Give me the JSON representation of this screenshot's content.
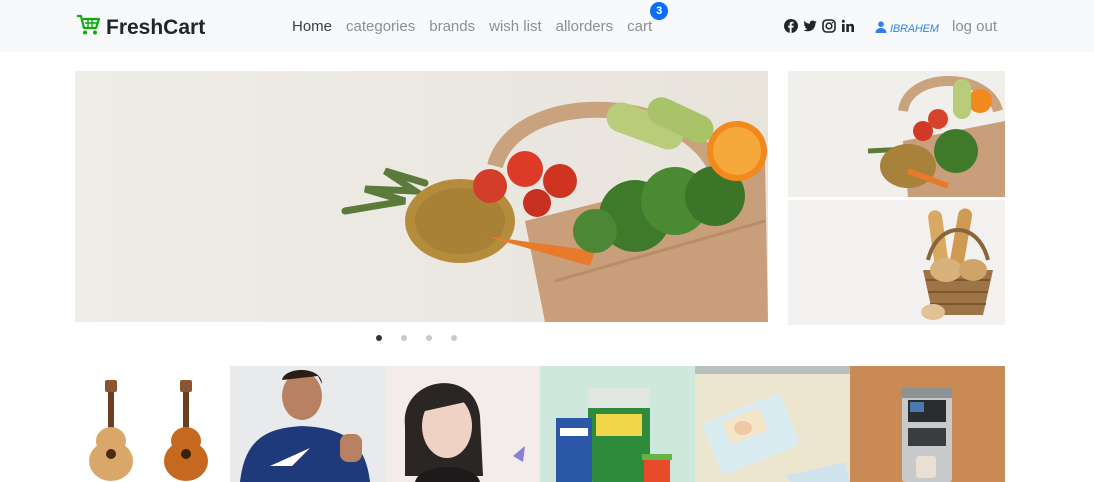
{
  "brand": {
    "name": "FreshCart",
    "icon": "cart-icon",
    "accent": "#0aad0a"
  },
  "nav": {
    "links": [
      {
        "label": "Home",
        "active": true
      },
      {
        "label": "categories"
      },
      {
        "label": "brands"
      },
      {
        "label": "wish list"
      },
      {
        "label": "allorders"
      },
      {
        "label": "cart"
      }
    ],
    "cart_count": "3",
    "badge_color": "#0d6efd"
  },
  "social": [
    "facebook-icon",
    "twitter-icon",
    "instagram-icon",
    "linkedin-icon"
  ],
  "user": {
    "name": "IBRAHEM",
    "icon": "user-icon"
  },
  "logout": "log out",
  "slider": {
    "slides_count": 4,
    "active_index": 0
  },
  "side_images": [
    {
      "name": "grocery-bag-image"
    },
    {
      "name": "bread-basket-image"
    }
  ],
  "categories": [
    {
      "name": "music-guitars"
    },
    {
      "name": "men-fashion"
    },
    {
      "name": "women-fashion"
    },
    {
      "name": "supermarket"
    },
    {
      "name": "baby-toys"
    },
    {
      "name": "home-appliances"
    }
  ]
}
